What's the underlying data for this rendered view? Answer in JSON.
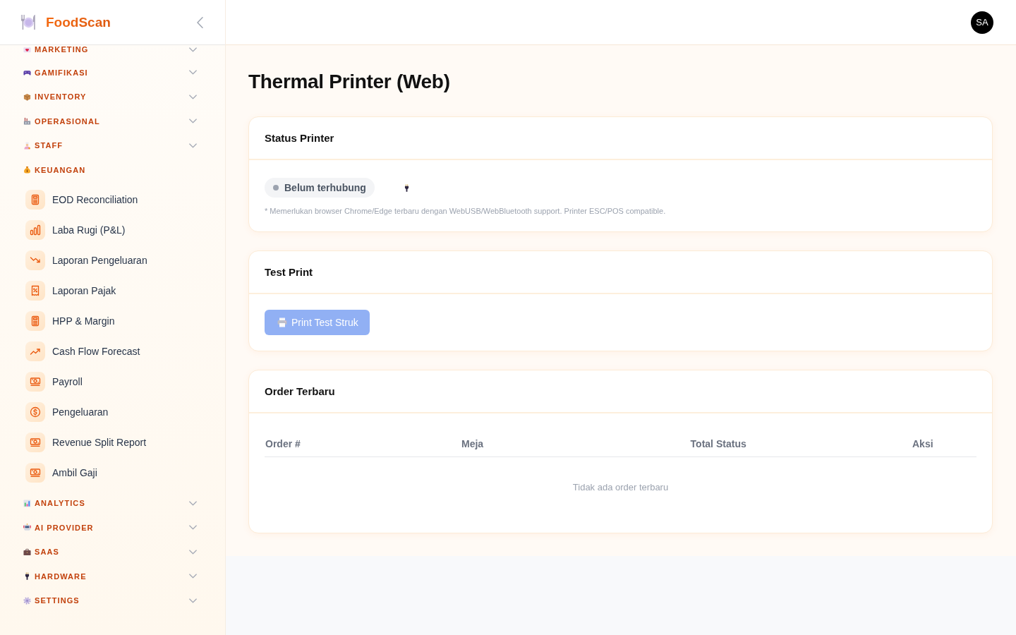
{
  "sidebar": {
    "brand": "FoodScan",
    "groups": [
      {
        "label": "MARKETING",
        "kind": "mail",
        "expanded": false
      },
      {
        "label": "GAMIFIKASI",
        "kind": "gamepad",
        "expanded": false
      },
      {
        "label": "INVENTORY",
        "kind": "box",
        "expanded": false
      },
      {
        "label": "OPERASIONAL",
        "kind": "factory",
        "expanded": false
      },
      {
        "label": "STAFF",
        "kind": "cook",
        "expanded": false
      },
      {
        "label": "KEUANGAN",
        "kind": "moneybag",
        "expanded": true,
        "items": [
          {
            "label": "EOD Reconciliation",
            "kind": "calculator",
            "selected": false
          },
          {
            "label": "Laba Rugi (P&L)",
            "kind": "chart",
            "selected": false
          },
          {
            "label": "Laporan Pengeluaran",
            "kind": "trenddown",
            "selected": false
          },
          {
            "label": "Laporan Pajak",
            "kind": "receipt",
            "selected": false
          },
          {
            "label": "HPP & Margin",
            "kind": "calculator",
            "selected": false
          },
          {
            "label": "Cash Flow Forecast",
            "kind": "trendup",
            "selected": false
          },
          {
            "label": "Payroll",
            "kind": "banknotes",
            "selected": false
          },
          {
            "label": "Pengeluaran",
            "kind": "coin",
            "selected": false
          },
          {
            "label": "Revenue Split Report",
            "kind": "banknotes",
            "selected": false
          },
          {
            "label": "Ambil Gaji",
            "kind": "banknotes",
            "selected": false
          }
        ]
      },
      {
        "label": "ANALYTICS",
        "kind": "chart",
        "expanded": false
      },
      {
        "label": "AI PROVIDER",
        "kind": "robot",
        "expanded": false
      },
      {
        "label": "SAAS",
        "kind": "briefcase",
        "expanded": false
      },
      {
        "label": "HARDWARE",
        "kind": "plug",
        "expanded": false
      },
      {
        "label": "SETTINGS",
        "kind": "gear",
        "expanded": false
      }
    ]
  },
  "top_bar": {
    "avatar": "SA"
  },
  "page": {
    "title": "Thermal Printer (Web)"
  },
  "status_printer": {
    "title": "Status Printer",
    "status": {
      "label": "Belum terhubung",
      "connected": false
    },
    "note": "* Memerlukan browser Chrome/Edge terbaru dengan WebUSB/WebBluetooth support. Printer ESC/POS compatible."
  },
  "test_print": {
    "title": "Test Print",
    "button": {
      "label": "Print Test Struk",
      "disabled": true
    }
  },
  "recent_orders": {
    "title": "Order Terbaru",
    "table": {
      "columns": [
        "Order #",
        "Meja",
        "Total",
        "Status",
        "Aksi"
      ],
      "empty_message": "Tidak ada order terbaru"
    }
  }
}
